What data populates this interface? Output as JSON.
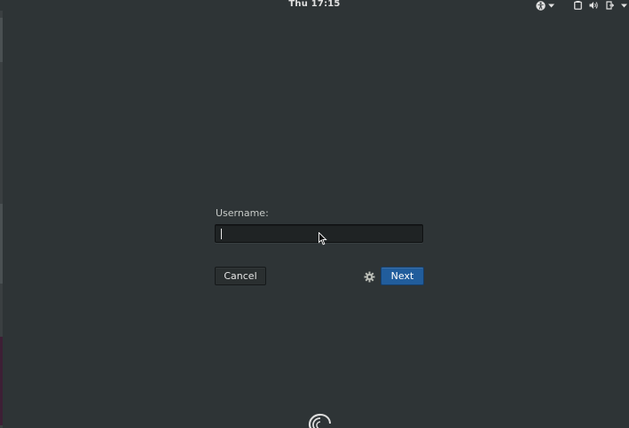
{
  "topbar": {
    "clock": "Thu 17:15",
    "icons": [
      "accessibility-icon",
      "chevron-down-icon",
      "window-icon",
      "volume-icon",
      "power-icon",
      "chevron-down-icon"
    ]
  },
  "login": {
    "username_label": "Username:",
    "username_value": "",
    "cancel_label": "Cancel",
    "next_label": "Next",
    "settings_icon": "gear-icon"
  },
  "branding": {
    "logo_icon": "debian-swirl-icon"
  },
  "colors": {
    "background": "#2e3436",
    "accent": "#215d9c",
    "text": "#c8ccc9"
  }
}
